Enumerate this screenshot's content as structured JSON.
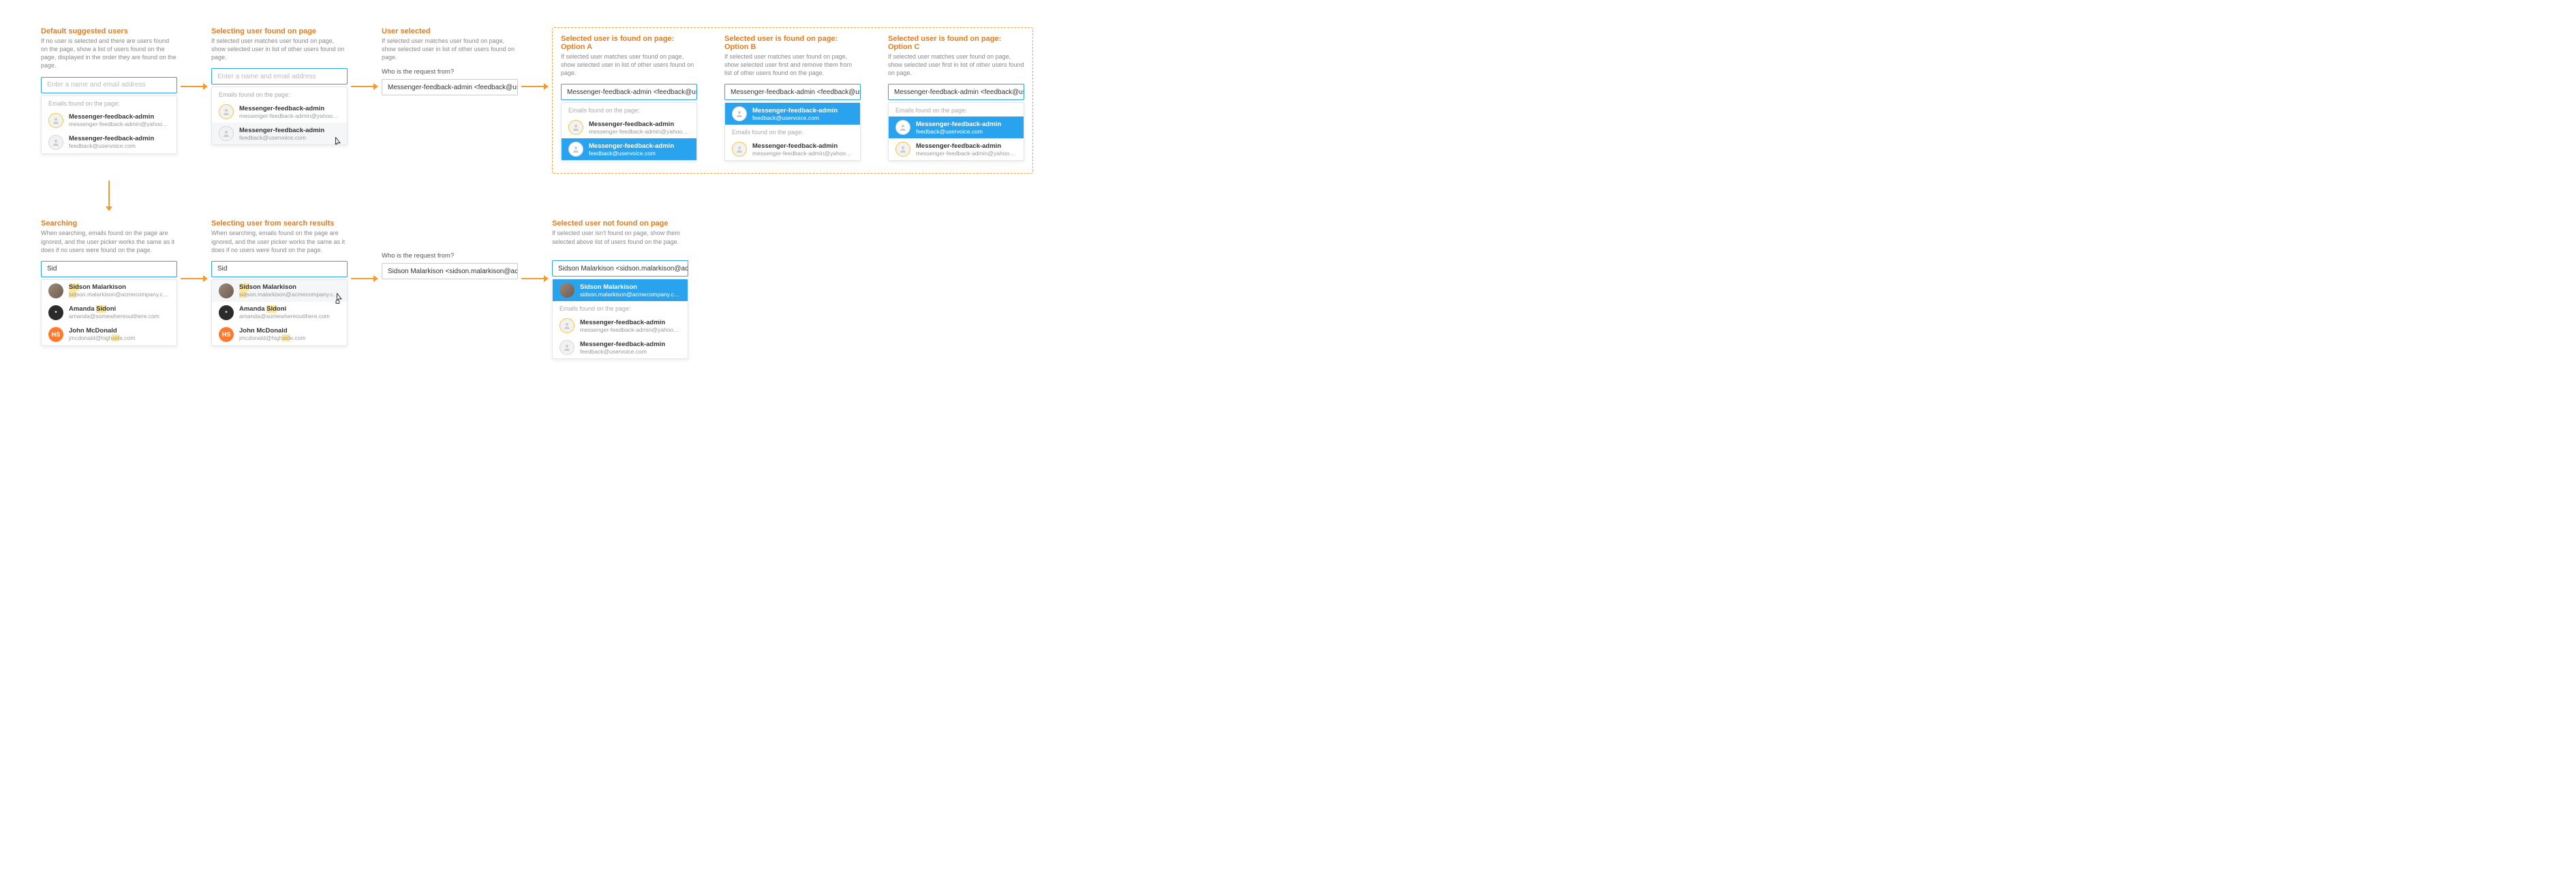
{
  "labels": {
    "emails_found": "Emails found on the page:",
    "who": "Who is the request from?",
    "placeholder": "Enter a name and email address"
  },
  "users": {
    "mfa_yahoo": {
      "name": "Messenger-feedback-admin",
      "email": "messenger-feedback-admin@yahoo-inc.com"
    },
    "mfa_uv": {
      "name": "Messenger-feedback-admin",
      "email": "feedback@uservoice.com"
    },
    "sidson": {
      "name": "Sidson Malarkison",
      "email": "sidson.malarkison@acmecompany.com"
    },
    "amanda": {
      "name": "Amanda Sidoni",
      "email": "amanda@somewhereoutthere.com"
    },
    "john": {
      "name": "John McDonald",
      "email": "jmcdonald@highside.com"
    }
  },
  "inputs": {
    "mfa_selected": "Messenger-feedback-admin <feedback@uservoice.com>",
    "sid": "Sid",
    "sidson_selected_short": "Sidson Malarkison <sidson.malarkison@acmecompany.",
    "sidson_selected_long": "Sidson Malarkison <sidson.malarkison@acmecompany.com>"
  },
  "states": {
    "s1": {
      "title": "Default suggested users",
      "desc": "If no user is selected and there are users found on the page, show a list of users found on the page, displayed in the order they are found on the page."
    },
    "s2": {
      "title": "Selecting user found on page",
      "desc": "If selected user matches user found on page, show selected user in list of other users found on page."
    },
    "s3": {
      "title": "User selected",
      "desc": "If selected user matches user found on page, show selected user in list of other users found on page."
    },
    "s4a": {
      "title": "Selected user is found on page: Option A",
      "desc": "If selected user matches user found on page, show selected user in list of other users found on page."
    },
    "s4b": {
      "title": "Selected user is found on page: Option B",
      "desc": "If selected user matches user found on page, show selected user first and remove them from list of other users found on the page."
    },
    "s4c": {
      "title": "Selected user is found on page: Option C",
      "desc": "If selected user matches user found on page, show selected user first in list of other users found on page."
    },
    "s5": {
      "title": "Searching",
      "desc": "When searching, emails found on the page are ignored, and the user picker works the same as it does if no users were found on the page."
    },
    "s6": {
      "title": "Selecting user from search results",
      "desc": "When searching, emails found on the page are ignored, and the user picker works the same as it does if no users were found on the page."
    },
    "s7": {
      "title": "Selected user not found on page",
      "desc": "If selected user isn't found on page, show them selected above list of users found on the page."
    }
  }
}
